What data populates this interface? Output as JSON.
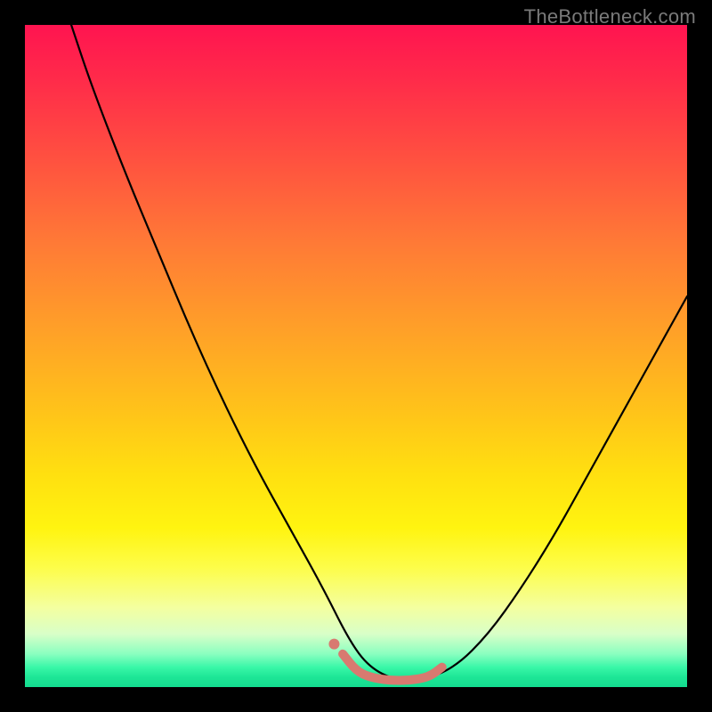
{
  "watermark": "TheBottleneck.com",
  "chart_data": {
    "type": "line",
    "title": "",
    "xlabel": "",
    "ylabel": "",
    "xlim": [
      0,
      100
    ],
    "ylim": [
      0,
      100
    ],
    "gradient_colors": {
      "top": "#ff1450",
      "mid_upper": "#ff7a36",
      "mid": "#ffe010",
      "mid_lower": "#fdfd4a",
      "bottom": "#14dc90"
    },
    "series": [
      {
        "name": "bottleneck-curve",
        "color": "#000000",
        "x": [
          7,
          10,
          15,
          20,
          25,
          30,
          35,
          40,
          45,
          49,
          52,
          56,
          60,
          65,
          70,
          75,
          80,
          85,
          90,
          95,
          100
        ],
        "values": [
          100,
          91,
          78,
          66,
          54,
          43,
          33,
          24,
          15,
          7,
          3,
          1,
          1,
          3,
          8,
          15,
          23,
          32,
          41,
          50,
          59
        ]
      },
      {
        "name": "optimal-range-marker",
        "color": "#d87a70",
        "x": [
          48,
          50,
          52,
          55,
          58,
          61,
          63
        ],
        "values": [
          5,
          2.5,
          1.5,
          1,
          1,
          1.5,
          3
        ]
      }
    ],
    "annotations": []
  }
}
